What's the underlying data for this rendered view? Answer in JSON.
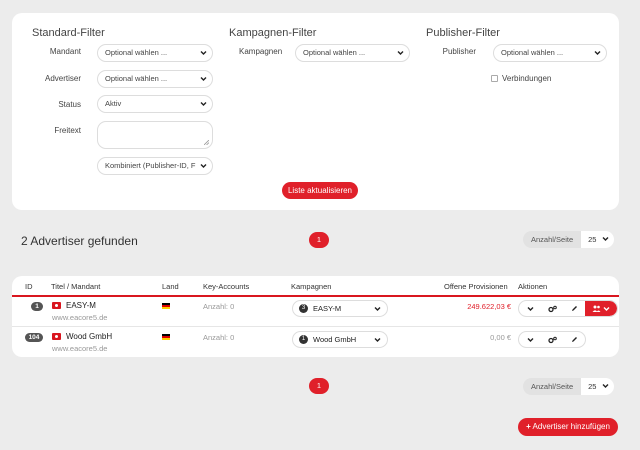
{
  "filters": {
    "standard": {
      "title": "Standard-Filter",
      "mandant_label": "Mandant",
      "mandant_value": "Optional wählen ...",
      "advertiser_label": "Advertiser",
      "advertiser_value": "Optional wählen ...",
      "status_label": "Status",
      "status_value": "Aktiv",
      "freitext_label": "Freitext",
      "freitext_value": "",
      "search_mode_value": "Kombiniert (Publisher-ID, F"
    },
    "kampagnen": {
      "title": "Kampagnen-Filter",
      "kampagnen_label": "Kampagnen",
      "kampagnen_value": "Optional wählen ..."
    },
    "publisher": {
      "title": "Publisher-Filter",
      "publisher_label": "Publisher",
      "publisher_value": "Optional wählen ...",
      "verbindungen_label": "Verbindungen"
    },
    "refresh_label": "Liste aktualisieren"
  },
  "results": {
    "count_text": "2 Advertiser gefunden",
    "page": "1",
    "per_page_label": "Anzahl/Seite",
    "per_page_value": "25"
  },
  "table": {
    "headers": {
      "id": "ID",
      "title": "Titel / Mandant",
      "land": "Land",
      "key_accounts": "Key-Accounts",
      "kampagnen": "Kampagnen",
      "provisionen": "Offene Provisionen",
      "aktionen": "Aktionen"
    },
    "rows": [
      {
        "id": "1",
        "name": "EASY-M",
        "url": "www.eacore5.de",
        "key_accounts": "Anzahl: 0",
        "campaign_count": "3",
        "campaign_name": "EASY-M",
        "provision": "249.622,03 €",
        "provision_color": "#e0202a"
      },
      {
        "id": "104",
        "name": "Wood GmbH",
        "url": "www.eacore5.de",
        "key_accounts": "Anzahl: 0",
        "campaign_count": "1",
        "campaign_name": "Wood GmbH",
        "provision": "0,00 €",
        "provision_color": "#999999"
      }
    ]
  },
  "footer": {
    "page": "1",
    "per_page_label": "Anzahl/Seite",
    "per_page_value": "25",
    "add_label": "Advertiser hinzufügen"
  },
  "colors": {
    "accent": "#e0202a",
    "background": "#ececec"
  }
}
